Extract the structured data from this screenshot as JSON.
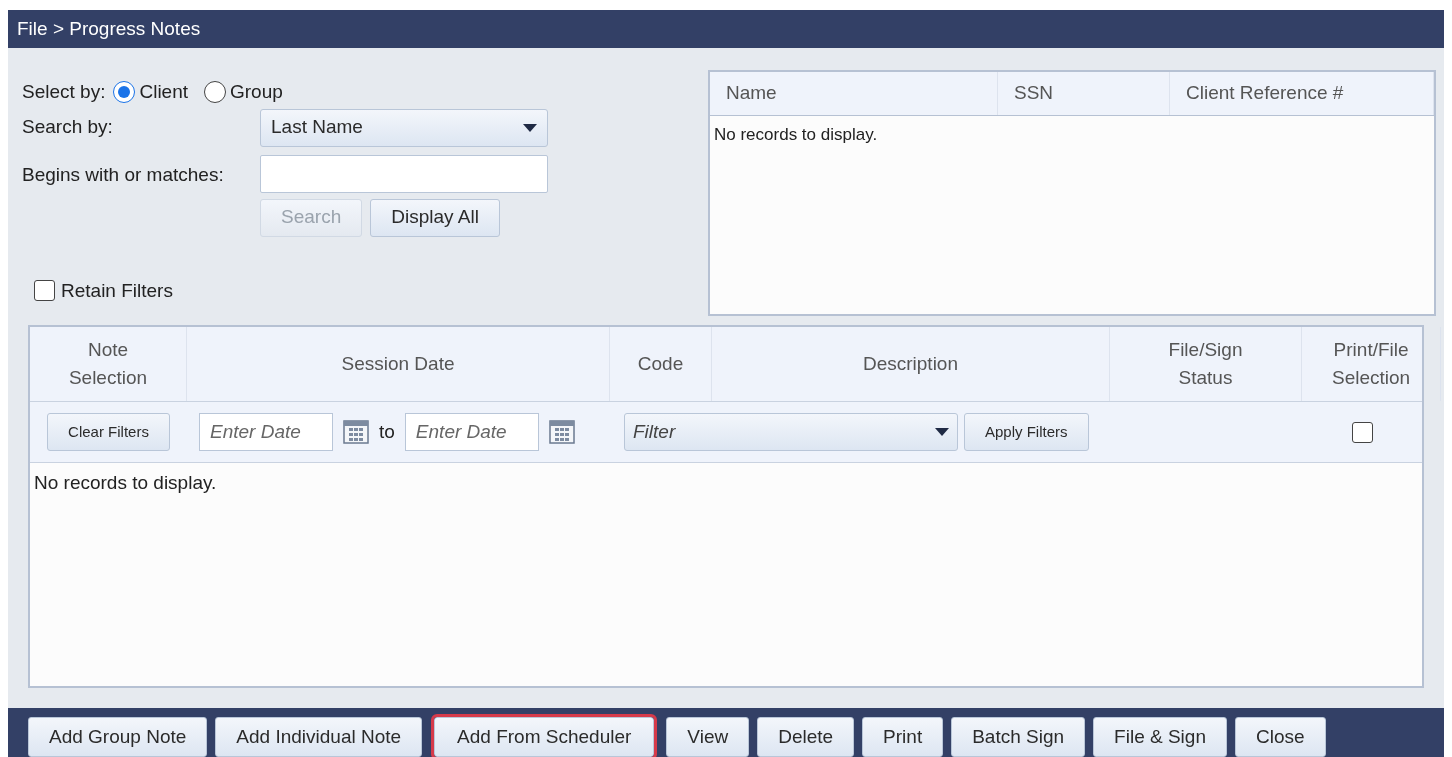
{
  "window": {
    "title": "File > Progress Notes"
  },
  "select_by": {
    "label": "Select by:",
    "options": [
      {
        "label": "Client",
        "selected": true
      },
      {
        "label": "Group",
        "selected": false
      }
    ]
  },
  "search_by": {
    "label": "Search by:",
    "value": "Last Name"
  },
  "match": {
    "label": "Begins with or matches:"
  },
  "search_buttons": [
    {
      "label": "Search",
      "disabled": true
    },
    {
      "label": "Display All",
      "disabled": false
    }
  ],
  "retain_filters": {
    "label": "Retain Filters",
    "checked": false
  },
  "client_table": {
    "columns": [
      "Name",
      "SSN",
      "Client Reference #"
    ],
    "empty_message": "No records to display."
  },
  "notes_table": {
    "columns": [
      "Note Selection",
      "Session Date",
      "Code",
      "Description",
      "File/Sign Status",
      "Print/File Selection"
    ],
    "filters": {
      "clear": "Clear Filters",
      "date_from_placeholder": "Enter Date",
      "to": "to",
      "date_to_placeholder": "Enter Date",
      "code": "Filter",
      "apply": "Apply Filters",
      "select_all_checked": false
    },
    "empty_message": "No records to display."
  },
  "footer_buttons": [
    {
      "label": "Add Group Note",
      "highlighted": false
    },
    {
      "label": "Add Individual Note",
      "highlighted": false
    },
    {
      "label": "Add From Scheduler",
      "highlighted": true
    },
    {
      "label": "View",
      "highlighted": false
    },
    {
      "label": "Delete",
      "highlighted": false
    },
    {
      "label": "Print",
      "highlighted": false
    },
    {
      "label": "Batch Sign",
      "highlighted": false
    },
    {
      "label": "File & Sign",
      "highlighted": false
    },
    {
      "label": "Close",
      "highlighted": false
    }
  ]
}
